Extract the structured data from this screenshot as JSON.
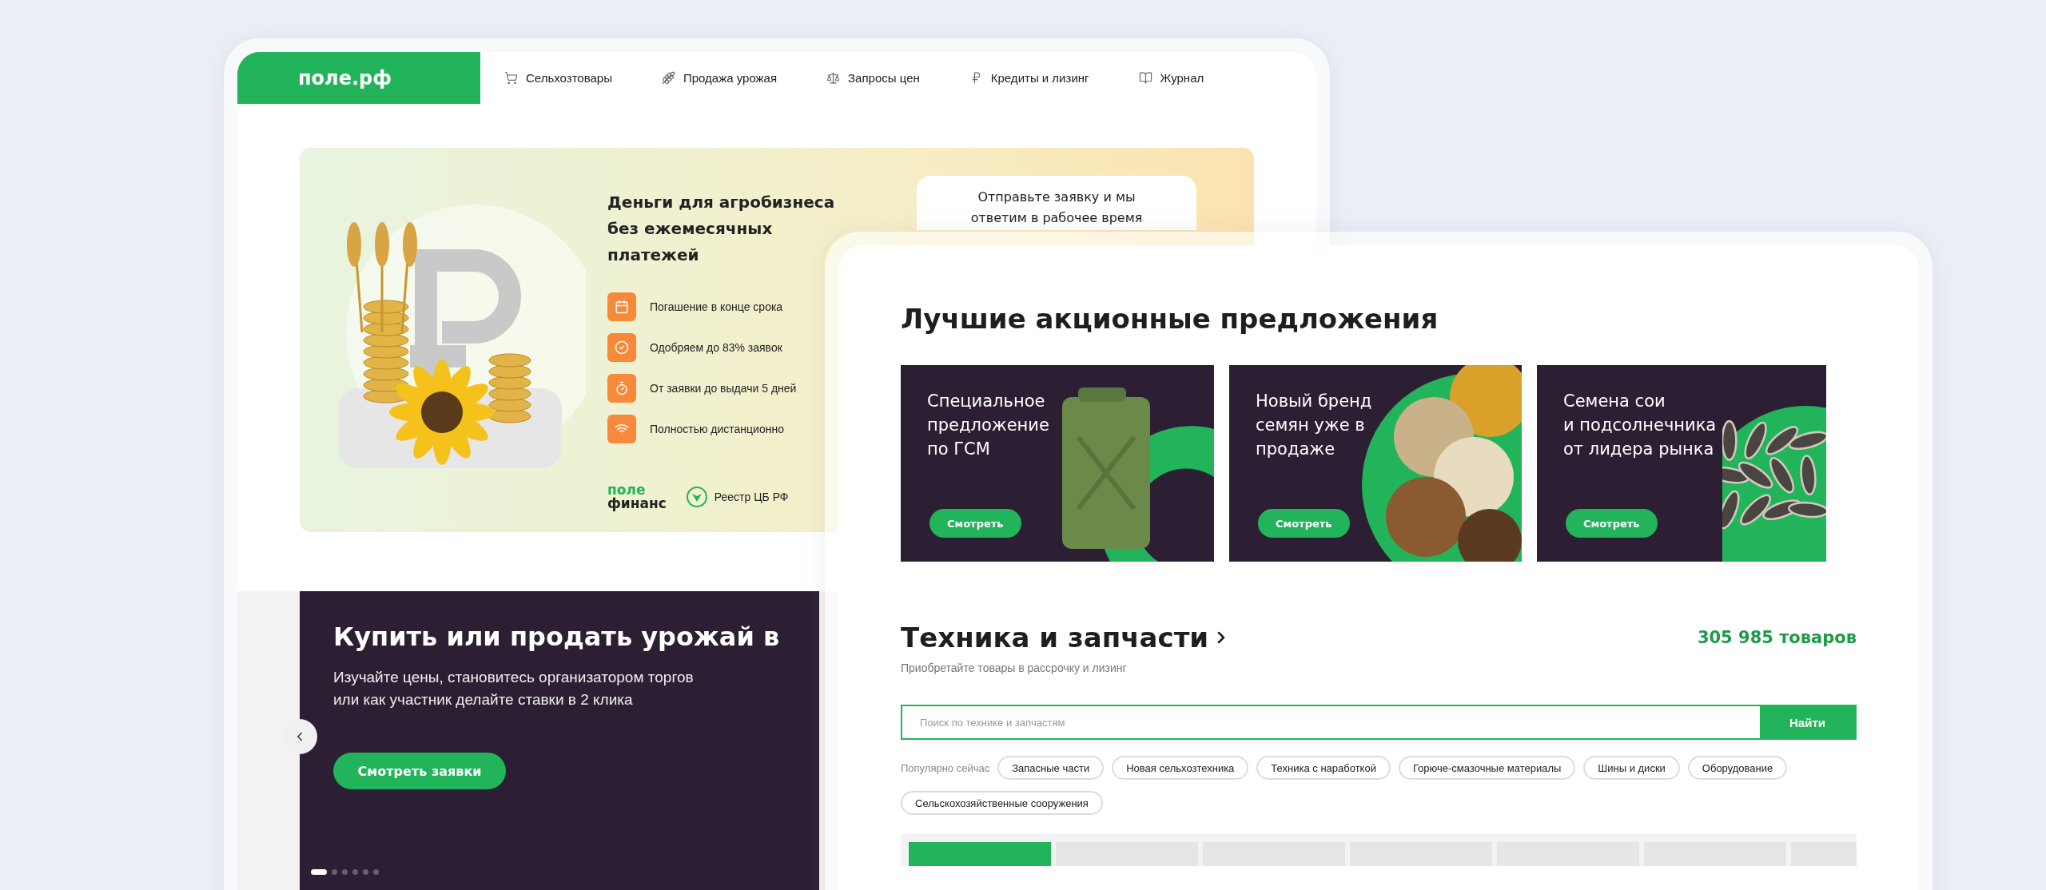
{
  "back_window": {
    "logo": "поле.рф",
    "nav": [
      "Сельхозтовары",
      "Продажа урожая",
      "Запросы цен",
      "Кредиты и лизинг",
      "Журнал"
    ],
    "promo": {
      "title": "Деньги для агробизнеса\nбез ежемесячных\nплатежей",
      "features": [
        "Погашение в конце срока",
        "Одобряем до 83% заявок",
        "От заявки до выдачи 5 дней",
        "Полностью дистанционно"
      ],
      "brand_top": "поле",
      "brand_bottom": "финанс",
      "registry": "Реестр ЦБ РФ",
      "form_card": "Отправьте заявку и мы\nответим в рабочее время"
    },
    "slider": {
      "title": "Купить или продать урожай в",
      "subtitle": "Изучайте цены, становитесь организатором торгов\nили как участник делайте ставки в 2 клика",
      "button": "Смотреть заявки",
      "dots": [
        {
          "selected": true
        },
        {
          "selected": false
        },
        {
          "selected": false
        },
        {
          "selected": false
        },
        {
          "selected": false
        },
        {
          "selected": false
        }
      ]
    }
  },
  "front_window": {
    "offers_title": "Лучшие акционные предложения",
    "offers": [
      {
        "title": "Специальное\nпредложение\nпо ГСМ",
        "button": "Смотреть",
        "kind": "canister"
      },
      {
        "title": "Новый бренд\nсемян уже в\nпродаже",
        "button": "Смотреть",
        "kind": "grains"
      },
      {
        "title": "Семена сои\nи подсолнечника\nот лидера рынка",
        "button": "Смотреть",
        "kind": "sunflower"
      }
    ],
    "section": {
      "title": "Техника и запчасти",
      "count": "305 985 товаров",
      "subtitle": "Приобретайте товары в рассрочку и лизинг",
      "search": {
        "placeholder": "Поиск по технике и запчастям",
        "button": "Найти"
      },
      "popular_label": "Популярно сейчас",
      "chips": [
        "Запасные части",
        "Новая сельхозтехника",
        "Техника с наработкой",
        "Горюче-смазочные материалы",
        "Шины и диски",
        "Оборудование",
        "Сельскохозяйственные сооружения"
      ],
      "tabs": [
        {
          "selected": true
        },
        {
          "selected": false
        },
        {
          "selected": false
        },
        {
          "selected": false
        },
        {
          "selected": false
        },
        {
          "selected": false
        },
        {
          "selected": false
        }
      ]
    }
  }
}
